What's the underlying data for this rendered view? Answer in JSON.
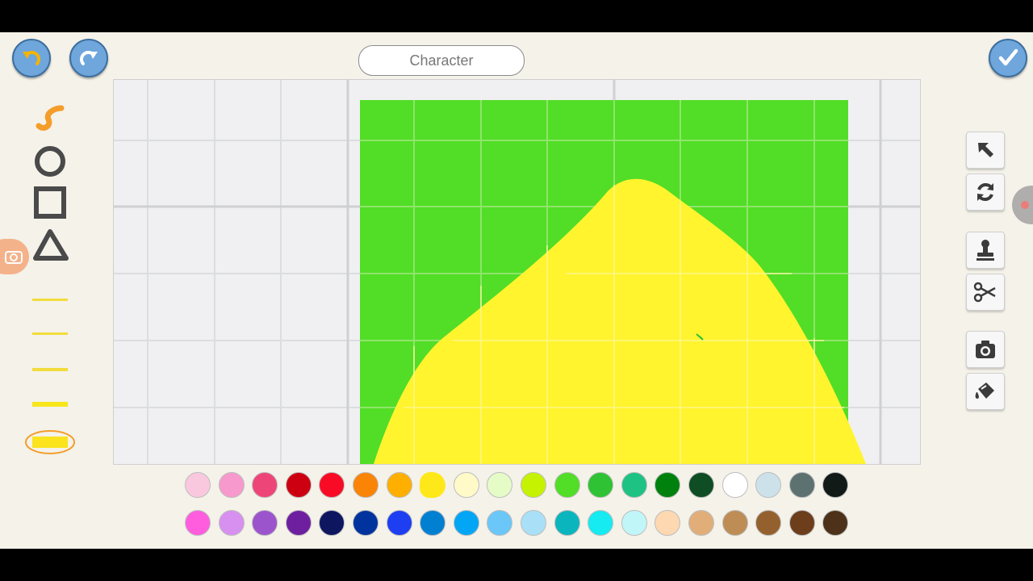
{
  "header": {
    "title": "Character"
  },
  "icons": {
    "undo": "undo-arrow-icon",
    "redo": "redo-arrow-icon",
    "confirm": "checkmark-icon",
    "freehand": "squiggle-pen-icon",
    "circle": "circle-shape-icon",
    "rectangle": "square-shape-icon",
    "triangle": "triangle-shape-icon",
    "pointer": "arrow-pointer-icon",
    "rotate": "rotate-icon",
    "stamp": "stamp-icon",
    "scissors": "scissors-icon",
    "camera": "camera-icon",
    "fill": "paint-bucket-icon"
  },
  "colors": {
    "accent": "#6fa6dc",
    "canvas_green": "#52dd27",
    "canvas_yellow": "#fff42e",
    "selected_color": "#ffe81a",
    "swatches_row1": [
      "#f9c8df",
      "#f799cc",
      "#ee4579",
      "#cc0010",
      "#fa0b25",
      "#fa8405",
      "#ffaf00",
      "#ffe81a",
      "#fffac8",
      "#e5fcc7",
      "#c5f200",
      "#52dd27",
      "#2fc234",
      "#1ec283",
      "#00800d",
      "#0f4d24",
      "#ffffff",
      "#cde1ea",
      "#5d7171",
      "#111a16"
    ],
    "swatches_row2": [
      "#ff5dde",
      "#d890f0",
      "#9c54cc",
      "#6e1fa0",
      "#0f1660",
      "#00339e",
      "#1e3ef2",
      "#0180d2",
      "#03a6f5",
      "#6ac7f8",
      "#a9e0f7",
      "#0bb5bd",
      "#15ebf0",
      "#c1f6f9",
      "#fdd8b1",
      "#e1ae7a",
      "#be8d55",
      "#94612e",
      "#6c3e1b",
      "#4d3219"
    ]
  },
  "line_widths": [
    "thin",
    "medium",
    "thick",
    "extra-thick",
    "marker"
  ],
  "selected_line_width": "marker"
}
